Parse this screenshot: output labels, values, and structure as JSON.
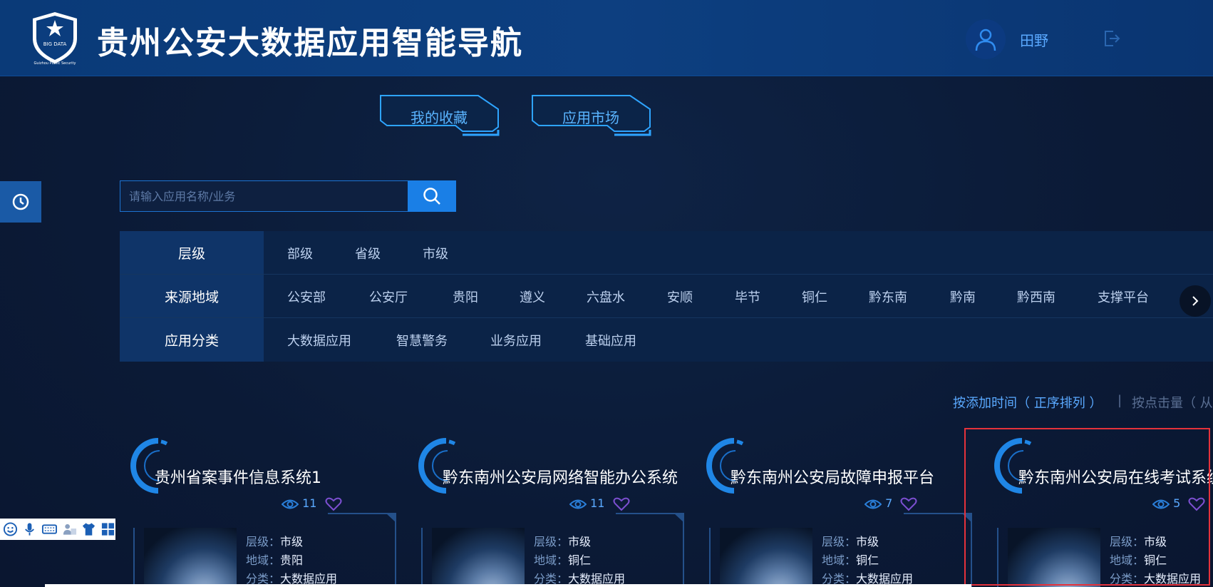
{
  "header": {
    "title": "贵州公安大数据应用智能导航",
    "logo_text": "BIG DATA",
    "logo_subtext": "Guizhou Public Security",
    "user_name": "田野"
  },
  "tabs": [
    {
      "label": "我的收藏"
    },
    {
      "label": "应用市场"
    }
  ],
  "search": {
    "placeholder": "请输入应用名称/业务",
    "value": ""
  },
  "filters": {
    "level": {
      "label": "层级",
      "options": [
        "部级",
        "省级",
        "市级"
      ]
    },
    "region": {
      "label": "来源地域",
      "options": [
        "公安部",
        "公安厅",
        "贵阳",
        "遵义",
        "六盘水",
        "安顺",
        "毕节",
        "铜仁",
        "黔东南",
        "黔南",
        "黔西南",
        "支撑平台"
      ]
    },
    "category": {
      "label": "应用分类",
      "options": [
        "大数据应用",
        "智慧警务",
        "业务应用",
        "基础应用"
      ]
    }
  },
  "sort": {
    "active": "按添加时间（ 正序排列 ）",
    "separator": "|",
    "other": "按点击量（ 从"
  },
  "info_keys": {
    "level": "层级：",
    "region": "地域：",
    "category": "分类："
  },
  "cards": [
    {
      "title": "贵州省案事件信息系统1",
      "views": "11",
      "level": "市级",
      "region": "贵阳",
      "category": "大数据应用"
    },
    {
      "title": "黔东南州公安局网络智能办公系统",
      "views": "11",
      "level": "市级",
      "region": "铜仁",
      "category": "大数据应用"
    },
    {
      "title": "黔东南州公安局故障申报平台",
      "views": "7",
      "level": "市级",
      "region": "铜仁",
      "category": "大数据应用"
    },
    {
      "title": "黔东南州公安局在线考试系统",
      "views": "5",
      "level": "市级",
      "region": "铜仁",
      "category": "大数据应用"
    }
  ],
  "colors": {
    "header_bg": "#0a3a78",
    "page_bg": "#0c1a36",
    "accent": "#1a7fe6",
    "link": "#5aa9ff",
    "highlight": "#e5323b"
  }
}
